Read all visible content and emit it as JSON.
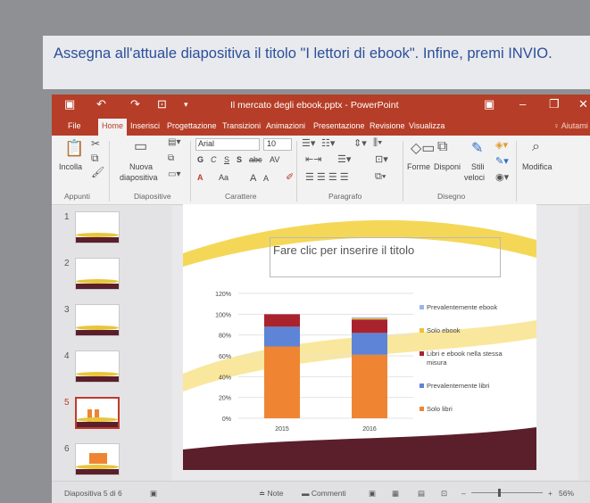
{
  "instruction": "Assegna all'attuale diapositiva il titolo \"I lettori di ebook\". Infine, premi INVIO.",
  "window": {
    "title": "Il mercato degli ebook.pptx - PowerPoint"
  },
  "tabs": [
    "File",
    "Home",
    "Inserisci",
    "Progettazione",
    "Transizioni",
    "Animazioni",
    "Presentazione",
    "Revisione",
    "Visualizza"
  ],
  "tell_me": "Aiutami",
  "ribbon": {
    "paste": "Incolla",
    "new_slide_1": "Nuova",
    "new_slide_2": "diapositiva",
    "font_name": "Arial",
    "font_size": "10",
    "bold": "G",
    "italic": "C",
    "underline": "S",
    "shadow": "S",
    "strike": "abc",
    "spacing": "AV",
    "font_color": "A",
    "change_case": "Aa",
    "grow": "A",
    "shrink": "A",
    "shapes": "Forme",
    "arrange": "Disponi",
    "quick_styles_1": "Stili",
    "quick_styles_2": "veloci",
    "edit": "Modifica",
    "groups": [
      "Appunti",
      "Diapositive",
      "Carattere",
      "Paragrafo",
      "Disegno"
    ]
  },
  "slides": {
    "numbers": [
      "1",
      "2",
      "3",
      "4",
      "5",
      "6"
    ],
    "selected": 5
  },
  "slide": {
    "title_placeholder": "Fare clic per inserire il titolo"
  },
  "chart_data": {
    "type": "bar",
    "stacked": true,
    "categories": [
      "2015",
      "2016"
    ],
    "ylim": [
      0,
      120
    ],
    "yticks": [
      "0%",
      "20%",
      "40%",
      "60%",
      "80%",
      "100%",
      "120%"
    ],
    "series": [
      {
        "name": "Solo libri",
        "color": "#ef8533",
        "values": [
          69,
          61
        ]
      },
      {
        "name": "Prevalentemente libri",
        "color": "#5d84d6",
        "values": [
          19,
          21
        ]
      },
      {
        "name": "Libri e ebook nella stessa misura",
        "color": "#a9232f",
        "values": [
          12,
          13
        ]
      },
      {
        "name": "Solo ebook",
        "color": "#f1c232",
        "values": [
          0,
          1
        ]
      },
      {
        "name": "Prevalentemente ebook",
        "color": "#9db3e8",
        "values": [
          0,
          1
        ]
      }
    ],
    "legend": "right"
  },
  "statusbar": {
    "slide_info": "Diapositiva 5 di 6",
    "notes": "Note",
    "comments": "Commenti",
    "zoom": "56%"
  }
}
